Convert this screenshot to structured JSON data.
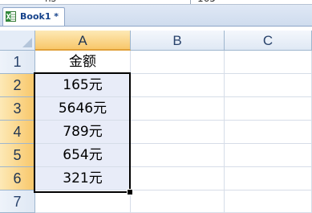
{
  "top_cutoff": {
    "left_text": "ns",
    "right_text": "165"
  },
  "tab": {
    "title": "Book1 *",
    "icon": "excel-workbook-icon"
  },
  "columns": [
    "A",
    "B",
    "C"
  ],
  "rows": [
    {
      "num": "1",
      "a": "金额"
    },
    {
      "num": "2",
      "a": "165元"
    },
    {
      "num": "3",
      "a": "5646元"
    },
    {
      "num": "4",
      "a": "789元"
    },
    {
      "num": "5",
      "a": "654元"
    },
    {
      "num": "6",
      "a": "321元"
    },
    {
      "num": "7",
      "a": ""
    }
  ],
  "selection": {
    "range": "A2:A6"
  },
  "colors": {
    "selected_header": "#f8c76a",
    "selected_cell_fill": "#e8ecf8",
    "tab_text": "#15428b"
  }
}
